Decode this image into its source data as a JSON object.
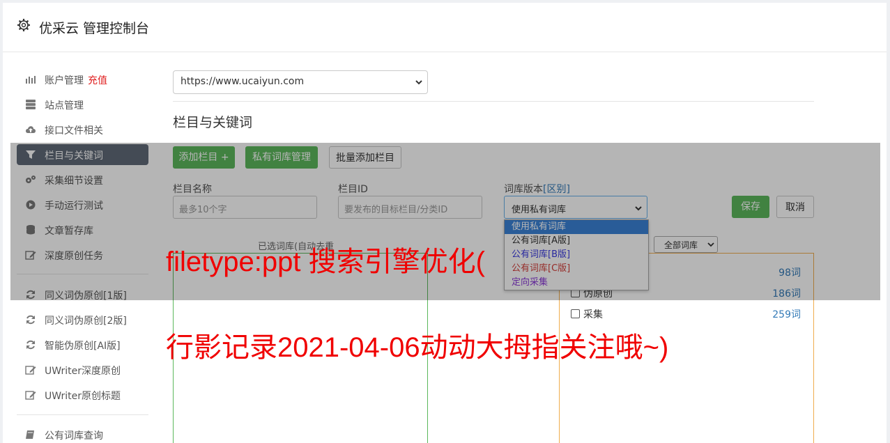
{
  "header": {
    "title": "优采云 管理控制台",
    "icon": "gear-icon"
  },
  "sidebar": {
    "items": [
      {
        "icon": "bar-chart-icon",
        "label": "账户管理",
        "extra": "充值"
      },
      {
        "icon": "server-icon",
        "label": "站点管理"
      },
      {
        "icon": "cloud-upload-icon",
        "label": "接口文件相关"
      },
      {
        "icon": "filter-icon",
        "label": "栏目与关键词",
        "active": true
      },
      {
        "icon": "cogs-icon",
        "label": "采集细节设置"
      },
      {
        "icon": "play-circle-icon",
        "label": "手动运行测试"
      },
      {
        "icon": "database-icon",
        "label": "文章暂存库"
      },
      {
        "icon": "edit-icon",
        "label": "深度原创任务"
      },
      {
        "icon": "refresh-icon",
        "label": "同义词伪原创[1版]"
      },
      {
        "icon": "refresh-icon",
        "label": "同义词伪原创[2版]"
      },
      {
        "icon": "refresh-icon",
        "label": "智能伪原创[AI版]"
      },
      {
        "icon": "edit-icon",
        "label": "UWriter深度原创"
      },
      {
        "icon": "edit-icon",
        "label": "UWriter原创标题"
      },
      {
        "icon": "book-icon",
        "label": "公有词库查询"
      }
    ]
  },
  "main": {
    "site_select": {
      "value": "https://www.ucaiyun.com"
    },
    "section_title": "栏目与关键词",
    "buttons": {
      "add_column": "添加栏目 +",
      "private_lib": "私有词库管理",
      "batch_add": "批量添加栏目",
      "save": "保存",
      "cancel": "取消"
    },
    "form": {
      "name_label": "栏目名称",
      "name_placeholder": "最多10个字",
      "id_label": "栏目ID",
      "id_placeholder": "要发布的目标栏目/分类ID",
      "version_label": "词库版本",
      "version_link": "[区别]",
      "version_value": "使用私有词库"
    },
    "dropdown_options": [
      {
        "label": "使用私有词库",
        "color": "#ffffff"
      },
      {
        "label": "公有词库[A版]",
        "color": "#333333"
      },
      {
        "label": "公有词库[B版]",
        "color": "#3a3ae0"
      },
      {
        "label": "公有词库[C版]",
        "color": "#d43f3a"
      },
      {
        "label": "定向采集",
        "color": "#8a3ad6"
      }
    ],
    "selected_label": "已选词库(自动去重",
    "lib_filter": "全部词库",
    "libraries": [
      {
        "name": "",
        "count": "98词"
      },
      {
        "name": "伪原创",
        "count": "186词"
      },
      {
        "name": "采集",
        "count": "259词"
      }
    ]
  },
  "watermark": {
    "line1": "filetype:ppt 搜索引擎优化(",
    "line2": "行影记录2021-04-06动动大拇指关注哦~)"
  },
  "colors": {
    "accent_green": "#5cb85c",
    "active_bg": "#616a78",
    "link": "#337ab7",
    "watermark": "#f00000"
  }
}
